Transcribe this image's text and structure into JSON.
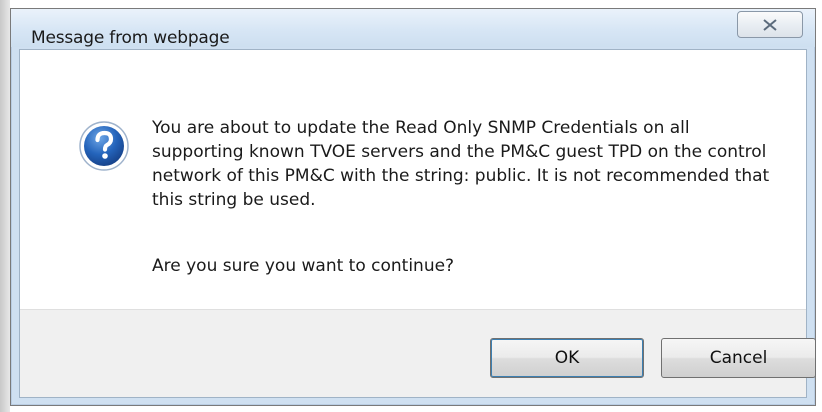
{
  "dialog": {
    "title": "Message from webpage",
    "close_icon": "close-x-icon",
    "message_icon": "question-icon",
    "message": "You are about to update the Read Only SNMP Credentials on all supporting known TVOE servers and the PM&C guest TPD on the control network of this PM&C with the string: public. It is not recommended that this string be used.",
    "question": "Are you sure you want to continue?",
    "buttons": {
      "ok_label": "OK",
      "cancel_label": "Cancel"
    }
  },
  "colors": {
    "titlebar": "#d7e6f5",
    "icon_blue": "#1f58a8",
    "footer": "#f0f0f0"
  }
}
